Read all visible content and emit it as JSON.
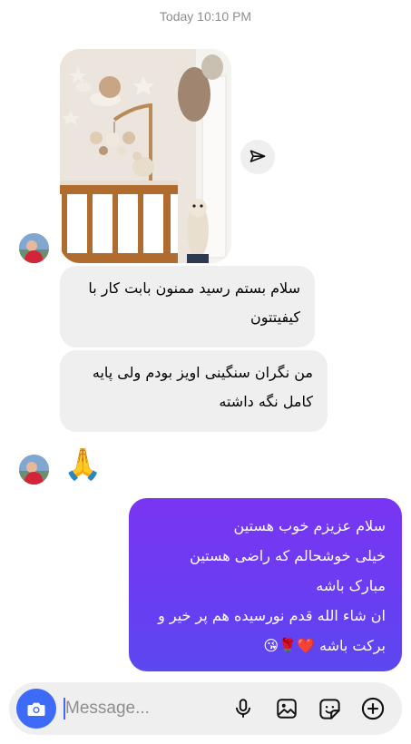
{
  "thread": {
    "timestamp": "Today 10:10 PM"
  },
  "messages": {
    "incoming": [
      "سلام بستم رسید ممنون بابت کار با کیفیتتون",
      "من نگران سنگینی اویز بودم ولی پایه کامل نگه داشته"
    ],
    "reaction_emoji": "🙏",
    "outgoing_lines": [
      "سلام عزیزم خوب هستین",
      "خیلی خوشحالم که راضی هستین",
      "مبارک باشه",
      "ان شاء الله قدم نورسیده هم پر خیر و",
      "برکت باشه ❤️🌹😘"
    ]
  },
  "composer": {
    "placeholder": "Message..."
  },
  "icons": {
    "share": "paper-plane-icon",
    "camera": "camera-icon",
    "mic": "microphone-icon",
    "gallery": "image-icon",
    "sticker": "sticker-icon",
    "add": "plus-circle-icon"
  },
  "colors": {
    "outgoing_gradient_top": "#7a35f3",
    "outgoing_gradient_bottom": "#5a48f0",
    "incoming_bubble": "#efefef",
    "camera_button": "#3d6af6",
    "timestamp_text": "#8e8e8e"
  }
}
